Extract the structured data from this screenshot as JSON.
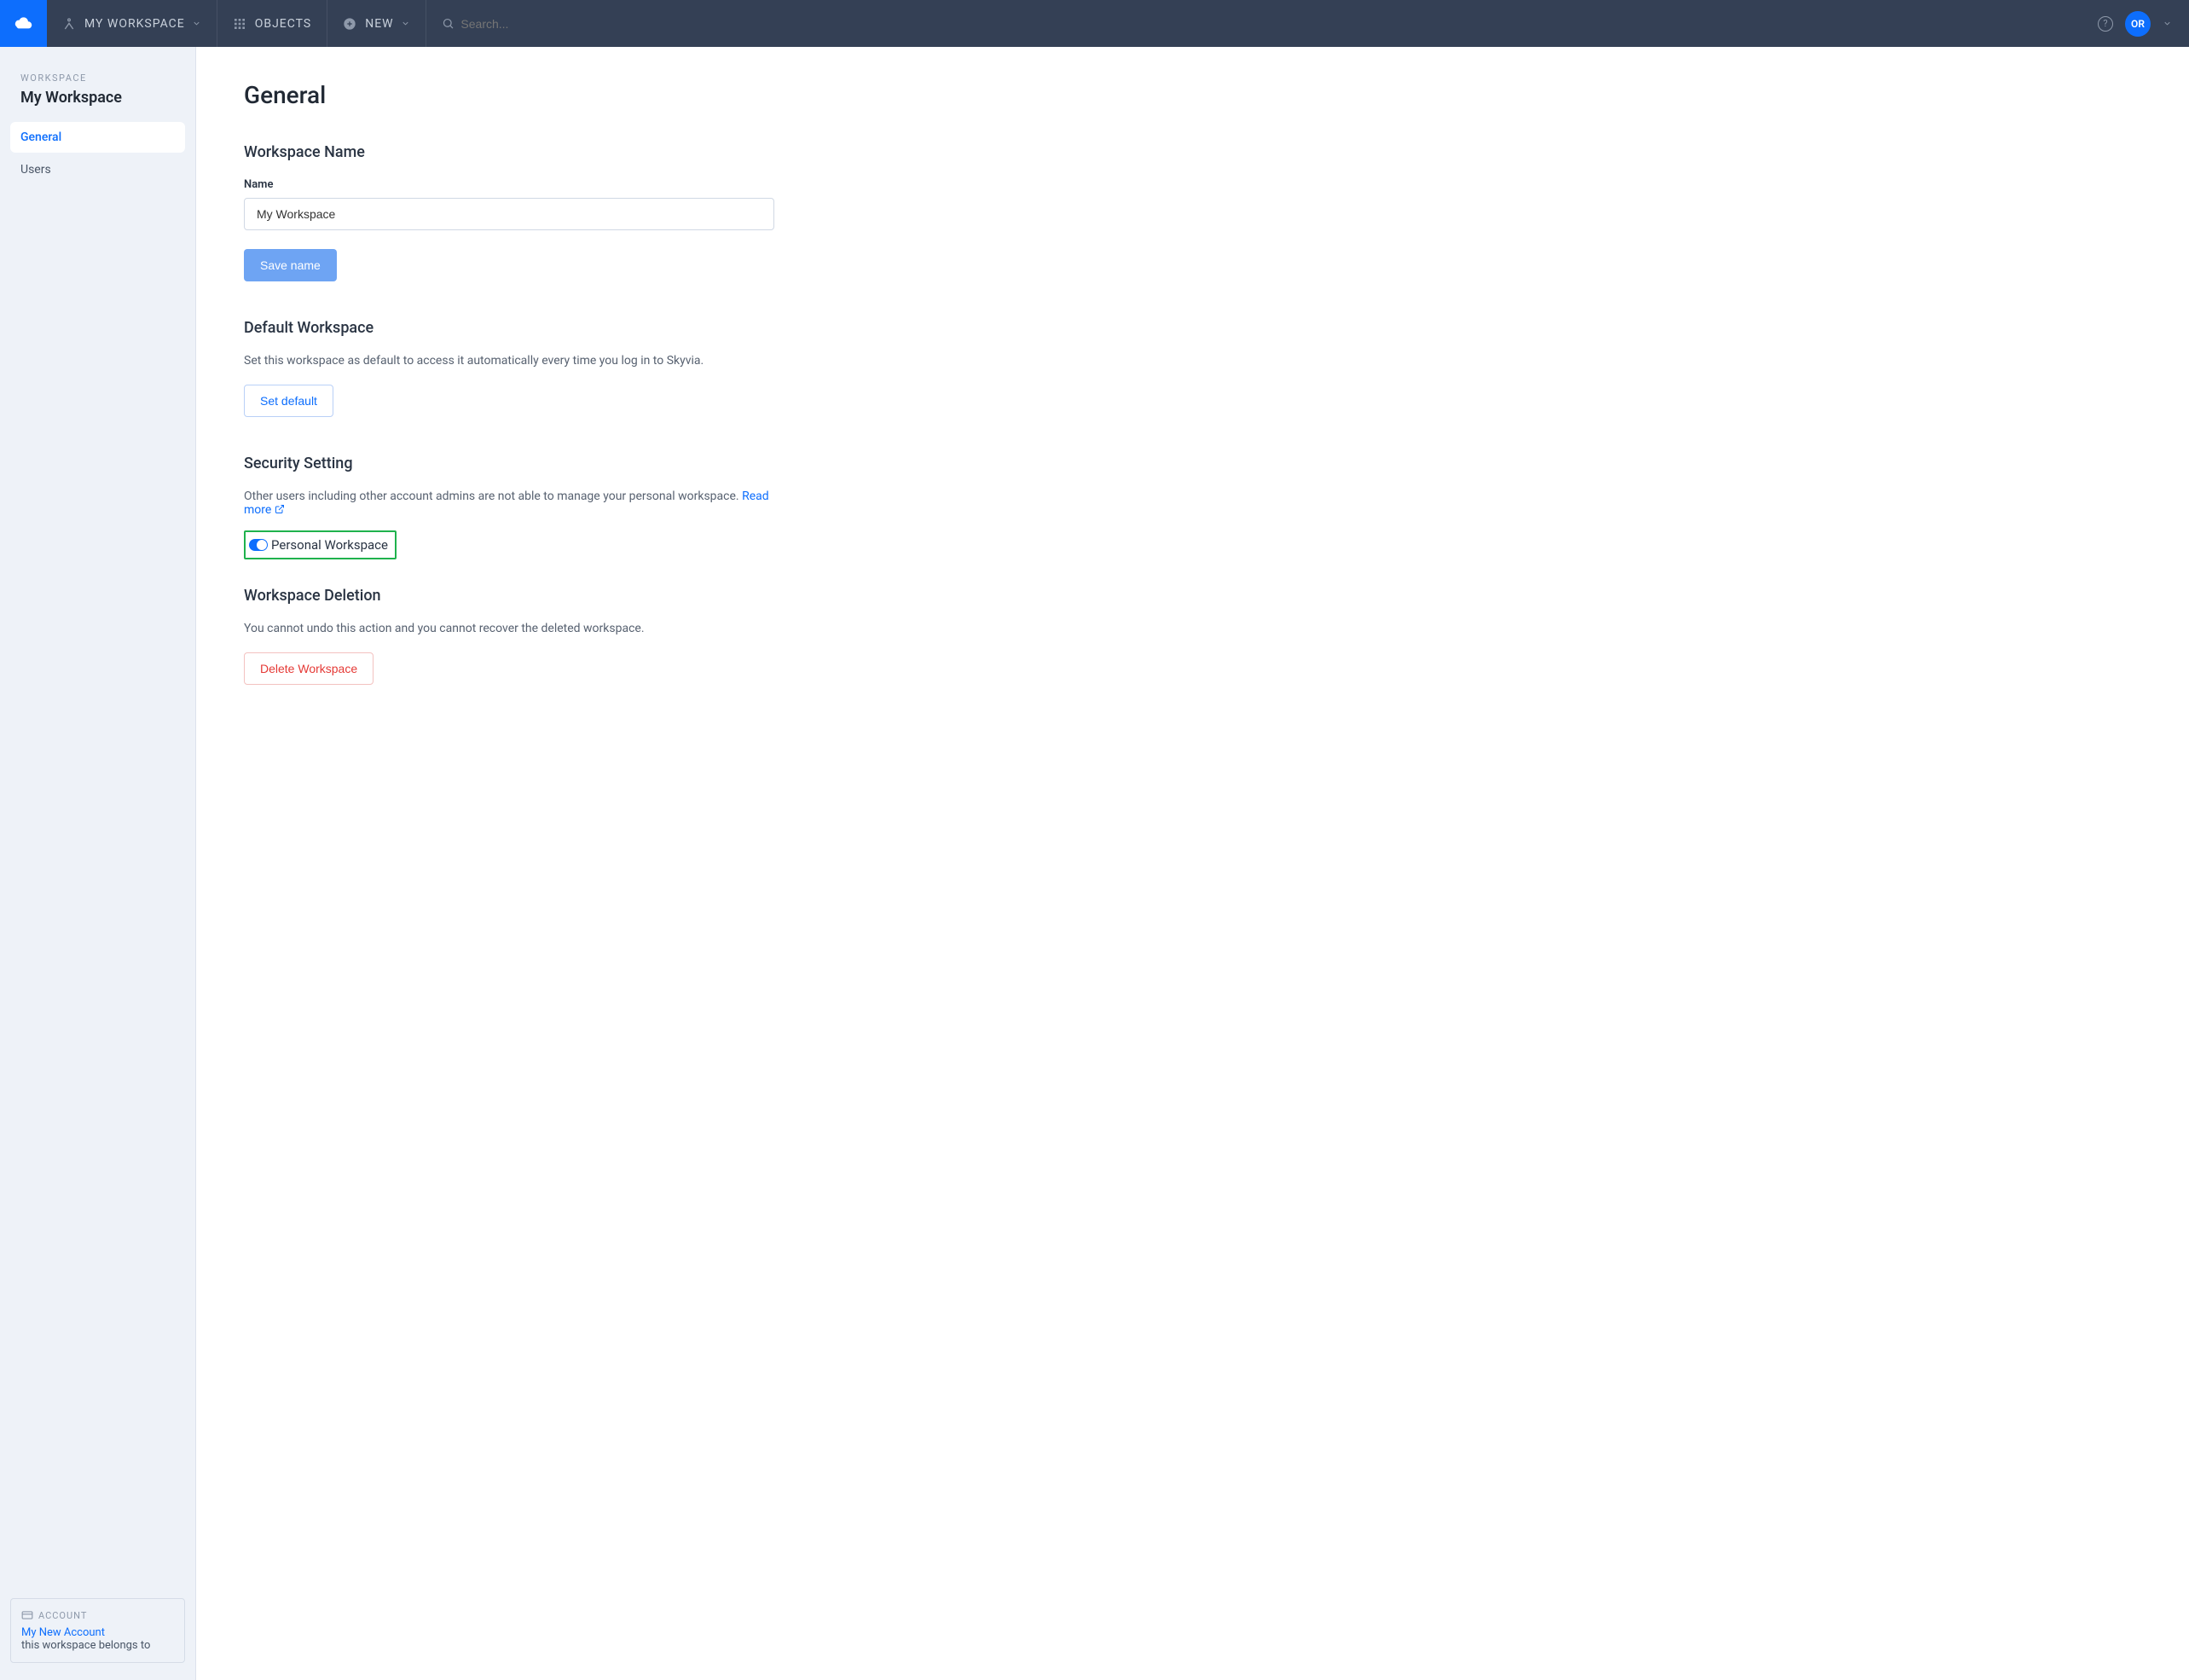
{
  "topbar": {
    "my_workspace": "MY WORKSPACE",
    "objects": "OBJECTS",
    "new": "NEW",
    "search_placeholder": "Search...",
    "avatar_initials": "OR"
  },
  "sidebar": {
    "crumb": "WORKSPACE",
    "ws_title": "My Workspace",
    "nav": {
      "general": "General",
      "users": "Users"
    },
    "account": {
      "hdr": "ACCOUNT",
      "link": "My New Account",
      "belongs": "this workspace belongs to"
    }
  },
  "page": {
    "title": "General",
    "workspace_name": {
      "heading": "Workspace Name",
      "label": "Name",
      "value": "My Workspace",
      "save_btn": "Save name"
    },
    "default_ws": {
      "heading": "Default Workspace",
      "desc": "Set this workspace as default to access it automatically every time you log in to Skyvia.",
      "btn": "Set default"
    },
    "security": {
      "heading": "Security Setting",
      "desc": "Other users including other account admins are not able to manage your personal workspace. ",
      "read_more": "Read more",
      "toggle_label": "Personal Workspace"
    },
    "deletion": {
      "heading": "Workspace Deletion",
      "desc": "You cannot undo this action and you cannot recover the deleted workspace.",
      "btn": "Delete Workspace"
    }
  }
}
